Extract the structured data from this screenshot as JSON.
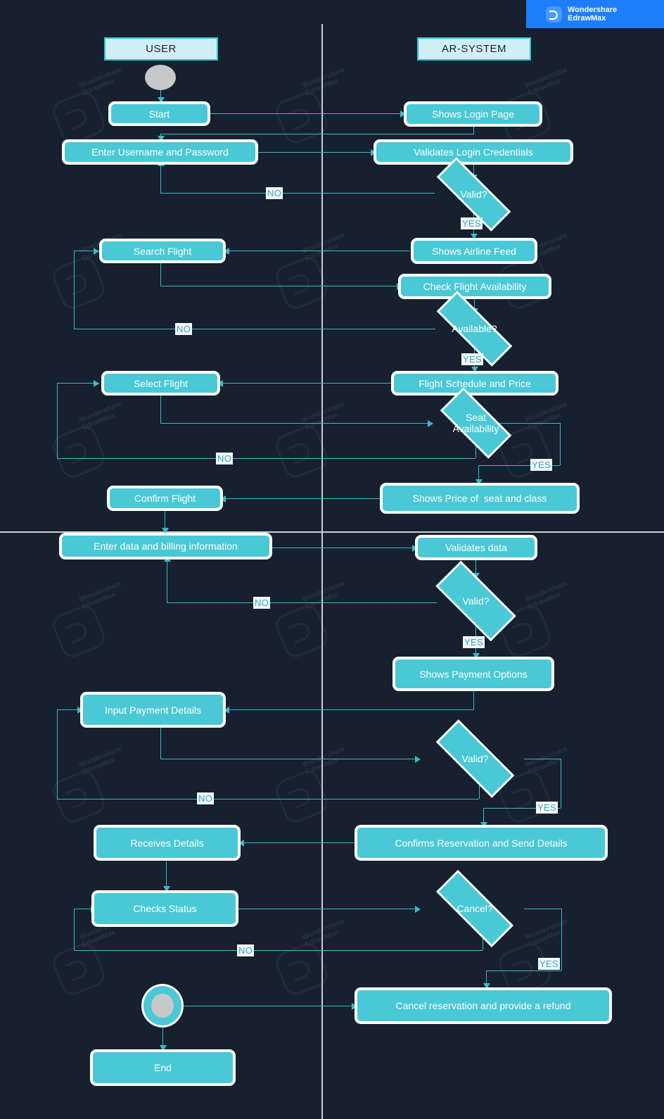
{
  "brand": {
    "line1": "Wondershare",
    "line2": "EdrawMax",
    "icon": "edraw-logo-icon",
    "bg": "#1d7efb"
  },
  "watermark": {
    "line1": "Wondershare",
    "line2": "EdrawMax"
  },
  "theme": {
    "background": "#16202e",
    "node_fill": "#4ac8d5",
    "node_border": "#ffffff",
    "connector": "#3fb8c9",
    "lane_line": "#c9cfd6",
    "lane_title_fill": "#cfeff5",
    "lane_title_border": "#2fc4d6",
    "label_fill": "#f2f6f7",
    "label_text": "#35a9c3",
    "terminator_grey": "#c6c8ca"
  },
  "lanes": [
    {
      "id": "user",
      "title": "USER"
    },
    {
      "id": "ar-system",
      "title": "AR-SYSTEM"
    }
  ],
  "nodes": {
    "start_dot": {
      "shape": "circle",
      "label": ""
    },
    "start": {
      "shape": "process",
      "label": "Start",
      "lane": "user"
    },
    "shows_login_page": {
      "shape": "process",
      "label": "Shows Login Page",
      "lane": "ar-system"
    },
    "enter_username_password": {
      "shape": "process",
      "label": "Enter Username and Password",
      "lane": "user"
    },
    "validates_login_credentials": {
      "shape": "process",
      "label": "Validates Login Credentials",
      "lane": "ar-system"
    },
    "valid_login": {
      "shape": "decision",
      "label": "Valid?",
      "lane": "ar-system"
    },
    "search_flight": {
      "shape": "process",
      "label": "Search Flight",
      "lane": "user"
    },
    "shows_airline_feed": {
      "shape": "process",
      "label": "Shows Airline Feed",
      "lane": "ar-system"
    },
    "check_flight_availability": {
      "shape": "process",
      "label": "Check Flight Availability",
      "lane": "ar-system"
    },
    "available": {
      "shape": "decision",
      "label": "Available?",
      "lane": "ar-system"
    },
    "select_flight": {
      "shape": "process",
      "label": "Select Flight",
      "lane": "user"
    },
    "flight_schedule_and_price": {
      "shape": "process",
      "label": "Flight Schedule and Price",
      "lane": "ar-system"
    },
    "seat_availability": {
      "shape": "decision",
      "label": "Seat\nAvailability",
      "lane": "ar-system"
    },
    "confirm_flight": {
      "shape": "process",
      "label": "Confirm Flight",
      "lane": "user"
    },
    "shows_price_seat_class": {
      "shape": "process",
      "label": "Shows Price of  seat and class",
      "lane": "ar-system"
    },
    "enter_data_billing": {
      "shape": "process",
      "label": "Enter data and billing information",
      "lane": "user"
    },
    "validates_data": {
      "shape": "process",
      "label": "Validates data",
      "lane": "ar-system"
    },
    "valid_data": {
      "shape": "decision",
      "label": "Valid?",
      "lane": "ar-system"
    },
    "shows_payment_options": {
      "shape": "process",
      "label": "Shows Payment Options",
      "lane": "ar-system"
    },
    "input_payment_details": {
      "shape": "process",
      "label": "Input Payment Details",
      "lane": "user"
    },
    "valid_payment": {
      "shape": "decision",
      "label": "Valid?",
      "lane": "ar-system"
    },
    "receives_details": {
      "shape": "process",
      "label": "Receives Details",
      "lane": "user"
    },
    "confirms_reservation": {
      "shape": "process",
      "label": "Confirms Reservation and Send Details",
      "lane": "ar-system"
    },
    "checks_status": {
      "shape": "process",
      "label": "Checks Status",
      "lane": "user"
    },
    "cancel": {
      "shape": "decision",
      "label": "Cancel?",
      "lane": "ar-system"
    },
    "terminator": {
      "shape": "terminator",
      "label": "",
      "lane": "user"
    },
    "cancel_reservation_refund": {
      "shape": "process",
      "label": "Cancel reservation and provide a refund",
      "lane": "ar-system"
    },
    "end": {
      "shape": "process",
      "label": "End",
      "lane": "user"
    }
  },
  "edge_labels": {
    "login_no": "NO",
    "login_yes": "YES",
    "available_no": "NO",
    "available_yes": "YES",
    "seat_no": "NO",
    "seat_yes": "YES",
    "data_no": "NO",
    "data_yes": "YES",
    "payment_no": "NO",
    "payment_yes": "YES",
    "cancel_no": "NO",
    "cancel_yes": "YES"
  },
  "chart_data": {
    "type": "table",
    "title": "Airline Reservation System Flowchart",
    "swimlanes": [
      "USER",
      "AR-SYSTEM"
    ],
    "steps": [
      {
        "from": "Start",
        "to": "Shows Login Page",
        "label": ""
      },
      {
        "from": "Shows Login Page",
        "to": "Enter Username and Password",
        "label": ""
      },
      {
        "from": "Enter Username and Password",
        "to": "Validates Login Credentials",
        "label": ""
      },
      {
        "from": "Validates Login Credentials",
        "to": "Valid?",
        "label": ""
      },
      {
        "from": "Valid?",
        "to": "Enter Username and Password",
        "label": "NO"
      },
      {
        "from": "Valid?",
        "to": "Shows Airline Feed",
        "label": "YES"
      },
      {
        "from": "Shows Airline Feed",
        "to": "Search Flight",
        "label": ""
      },
      {
        "from": "Search Flight",
        "to": "Check Flight Availability",
        "label": ""
      },
      {
        "from": "Check Flight Availability",
        "to": "Available?",
        "label": ""
      },
      {
        "from": "Available?",
        "to": "Search Flight",
        "label": "NO"
      },
      {
        "from": "Available?",
        "to": "Flight Schedule and Price",
        "label": "YES"
      },
      {
        "from": "Flight Schedule and Price",
        "to": "Select Flight",
        "label": ""
      },
      {
        "from": "Select Flight",
        "to": "Seat Availability",
        "label": ""
      },
      {
        "from": "Seat Availability",
        "to": "Select Flight",
        "label": "NO"
      },
      {
        "from": "Seat Availability",
        "to": "Shows Price of  seat and class",
        "label": "YES"
      },
      {
        "from": "Shows Price of  seat and class",
        "to": "Confirm Flight",
        "label": ""
      },
      {
        "from": "Confirm Flight",
        "to": "Enter data and billing information",
        "label": ""
      },
      {
        "from": "Enter data and billing information",
        "to": "Validates data",
        "label": ""
      },
      {
        "from": "Validates data",
        "to": "Valid?",
        "label": ""
      },
      {
        "from": "Valid?",
        "to": "Enter data and billing information",
        "label": "NO"
      },
      {
        "from": "Valid?",
        "to": "Shows Payment Options",
        "label": "YES"
      },
      {
        "from": "Shows Payment Options",
        "to": "Input Payment Details",
        "label": ""
      },
      {
        "from": "Input Payment Details",
        "to": "Valid?",
        "label": ""
      },
      {
        "from": "Valid?",
        "to": "Input Payment Details",
        "label": "NO"
      },
      {
        "from": "Valid?",
        "to": "Confirms Reservation and Send Details",
        "label": "YES"
      },
      {
        "from": "Confirms Reservation and Send Details",
        "to": "Receives Details",
        "label": ""
      },
      {
        "from": "Receives Details",
        "to": "Checks Status",
        "label": ""
      },
      {
        "from": "Checks Status",
        "to": "Cancel?",
        "label": ""
      },
      {
        "from": "Cancel?",
        "to": "Checks Status",
        "label": "NO"
      },
      {
        "from": "Cancel?",
        "to": "Cancel reservation and provide a refund",
        "label": "YES"
      },
      {
        "from": "Terminator",
        "to": "Cancel reservation and provide a refund",
        "label": ""
      },
      {
        "from": "Terminator",
        "to": "End",
        "label": ""
      }
    ]
  }
}
